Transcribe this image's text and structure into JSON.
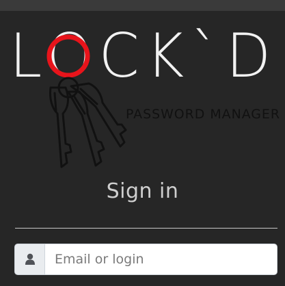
{
  "logo": {
    "name": "LOCK`D",
    "tagline": "PASSWORD MANAGER",
    "accent_color": "#e8141b",
    "letter_color": "#f2f2f2",
    "keys_icon": "keys-icon"
  },
  "signin": {
    "title": "Sign in"
  },
  "login": {
    "placeholder": "Email or login",
    "value": "",
    "icon": "user-icon"
  }
}
